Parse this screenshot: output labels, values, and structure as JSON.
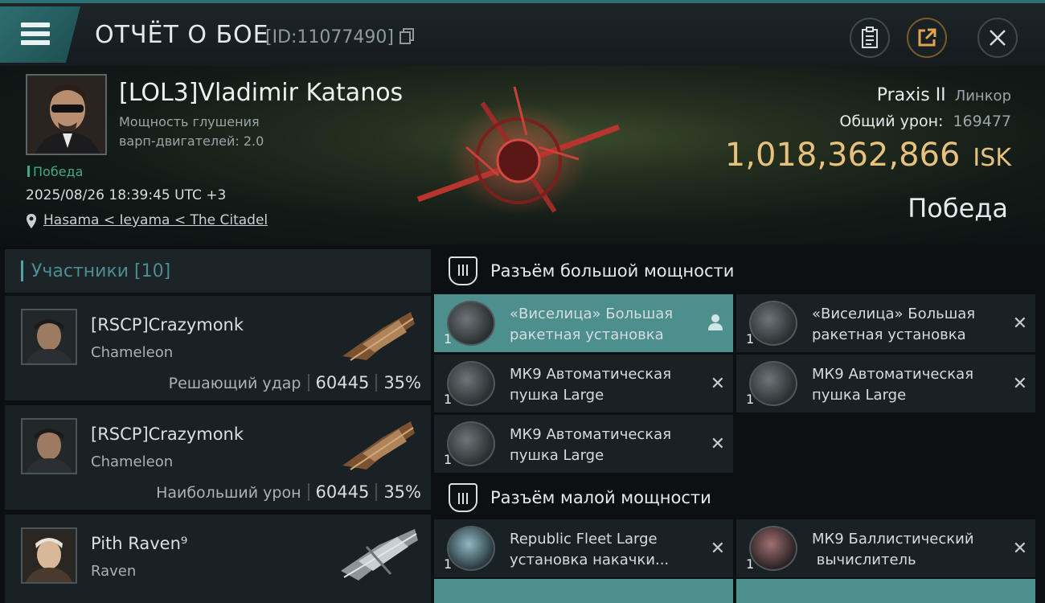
{
  "titlebar": {
    "title": "ОТЧЁТ О БОЕ",
    "report_id": "[ID:11077490]"
  },
  "victim": {
    "name": "[LOL3]Vladimir Katanos",
    "attribute_line1": "Мощность глушения",
    "attribute_line2": "варп-двигателей: 2.0",
    "status_tag": "Победа",
    "datetime": "2025/08/26 18:39:45 UTC +3",
    "location": "Hasama < Ieyama < The Citadel",
    "ship_name": "Praxis II",
    "ship_class": "Линкор",
    "total_damage_label": "Общий урон:",
    "total_damage": "169477",
    "isk_value": "1,018,362,866",
    "isk_unit": "ISK",
    "result": "Победа"
  },
  "participants": {
    "header": "Участники [10]",
    "items": [
      {
        "name": "[RSCP]Crazymonk",
        "ship": "Chameleon",
        "role": "Решающий удар",
        "damage": "60445",
        "percent": "35%"
      },
      {
        "name": "[RSCP]Crazymonk",
        "ship": "Chameleon",
        "role": "Наибольший урон",
        "damage": "60445",
        "percent": "35%"
      },
      {
        "name": "Pith Raven⁹",
        "ship": "Raven",
        "role": "",
        "damage": "",
        "percent": ""
      }
    ]
  },
  "fitting": {
    "high_slots_label": "Разъём большой мощности",
    "low_slots_label": "Разъём малой мощности",
    "high": [
      {
        "name_l1": "«Виселица» Большая",
        "name_l2": "ракетная установка",
        "count": "1"
      },
      {
        "name_l1": "«Виселица» Большая",
        "name_l2": "ракетная установка",
        "count": "1"
      },
      {
        "name_l1": "МК9 Автоматическая",
        "name_l2": "пушка Large",
        "count": "1"
      },
      {
        "name_l1": "МК9 Автоматическая",
        "name_l2": "пушка Large",
        "count": "1"
      },
      {
        "name_l1": "МК9 Автоматическая",
        "name_l2": "пушка Large",
        "count": "1"
      }
    ],
    "low": [
      {
        "name_l1": "Republic Fleet Large",
        "name_l2": "установка накачки...",
        "count": "1"
      },
      {
        "name_l1": "МК9 Баллистический",
        "name_l2": " вычислитель",
        "count": "1"
      }
    ]
  },
  "colors": {
    "accent": "#2d6e70",
    "isk": "#e8c27c",
    "win": "#3fa98a",
    "active_module": "#4d8f8d"
  }
}
